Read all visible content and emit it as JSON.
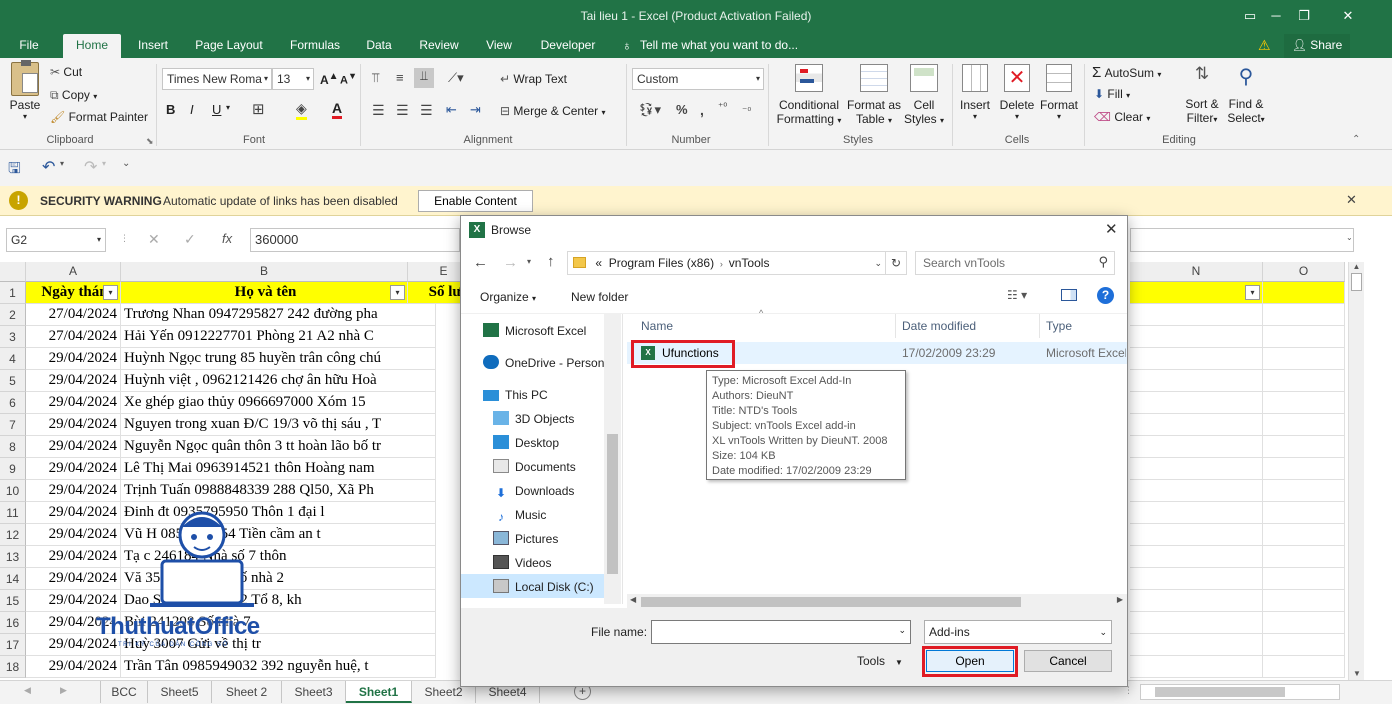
{
  "window": {
    "title": "Tai lieu 1 - Excel (Product Activation Failed)"
  },
  "menu": {
    "tabs": [
      "File",
      "Home",
      "Insert",
      "Page Layout",
      "Formulas",
      "Data",
      "Review",
      "View",
      "Developer"
    ],
    "tell_me": "Tell me what you want to do...",
    "share": "Share"
  },
  "ribbon": {
    "clipboard": {
      "paste": "Paste",
      "cut": "Cut",
      "copy": "Copy",
      "format_painter": "Format Painter",
      "label": "Clipboard"
    },
    "font": {
      "name": "Times New Roma",
      "size": "13",
      "bold": "B",
      "italic": "I",
      "underline": "U",
      "label": "Font"
    },
    "alignment": {
      "wrap_text": "Wrap Text",
      "merge_center": "Merge & Center",
      "label": "Alignment"
    },
    "number": {
      "format": "Custom",
      "label": "Number"
    },
    "styles": {
      "conditional": "Conditional",
      "conditional2": "Formatting",
      "format_as": "Format as",
      "format_as2": "Table",
      "cell": "Cell",
      "cell2": "Styles",
      "label": "Styles"
    },
    "cells": {
      "insert": "Insert",
      "delete": "Delete",
      "format": "Format",
      "label": "Cells"
    },
    "editing": {
      "autosum": "AutoSum",
      "fill": "Fill",
      "clear": "Clear",
      "sort": "Sort &",
      "sort2": "Filter",
      "find": "Find &",
      "find2": "Select",
      "label": "Editing"
    }
  },
  "security": {
    "title": "SECURITY WARNING",
    "message": "Automatic update of links has been disabled",
    "button": "Enable Content"
  },
  "formula": {
    "name_box": "G2",
    "fx": "fx",
    "value": "360000"
  },
  "grid": {
    "columns": {
      "a": "A",
      "b": "B",
      "e": "E",
      "n": "N",
      "o": "O"
    },
    "header": {
      "date": "Ngày thán",
      "name": "Họ và tên",
      "qty": "Số lư"
    },
    "rows": [
      {
        "num": "1"
      },
      {
        "num": "2",
        "date": "27/04/2024",
        "text": "Trương Nhan 0947295827 242 đường pha"
      },
      {
        "num": "3",
        "date": "27/04/2024",
        "text": "Hải Yến 0912227701 Phòng 21 A2 nhà C"
      },
      {
        "num": "4",
        "date": "29/04/2024",
        "text": "Huỳnh Ngọc trung 85 huyền trân công chú"
      },
      {
        "num": "5",
        "date": "29/04/2024",
        "text": "Huỳnh việt , 0962121426 chợ ân hữu Hoà"
      },
      {
        "num": "6",
        "date": "29/04/2024",
        "text": " Xe ghép giao thủy 0966697000 Xóm 15"
      },
      {
        "num": "7",
        "date": "29/04/2024",
        "text": "Nguyen trong xuan Đ/C 19/3 võ thị sáu , T"
      },
      {
        "num": "8",
        "date": "29/04/2024",
        "text": "Nguyễn Ngọc quân thôn 3 tt hoàn lão bố tr"
      },
      {
        "num": "9",
        "date": "29/04/2024",
        "text": "Lê Thị Mai 0963914521 thôn Hoàng nam"
      },
      {
        "num": "10",
        "date": "29/04/2024",
        "text": "Trịnh Tuấn 0988848339 288 Ql50, Xã Ph"
      },
      {
        "num": "11",
        "date": "29/04/2024",
        "text": "Đinh           đt 0935795950 Thôn 1 đại l"
      },
      {
        "num": "12",
        "date": "29/04/2024",
        "text": "Vũ H          0852865154 Tiền cầm an t"
      },
      {
        "num": "13",
        "date": "29/04/2024",
        "text": "Tạ c           246184 Nhà số 7 thôn"
      },
      {
        "num": "14",
        "date": "29/04/2024",
        "text": " Vă           35981 Địa chỉ số nhà 2"
      },
      {
        "num": "15",
        "date": "29/04/2024",
        "text": "Dao          Sdt0975163772 Tổ 8, kh"
      },
      {
        "num": "16",
        "date": "29/04/2024",
        "text": "Bùi          241298 Số nhà 7"
      },
      {
        "num": "17",
        "date": "29/04/2024",
        "text": "Huỳ          3007 Gửi về thị tr"
      },
      {
        "num": "18",
        "date": "29/04/2024",
        "text": "Trần Tân 0985949032 392  nguyễn huệ, t"
      }
    ]
  },
  "sheets": [
    "BCC",
    "Sheet5",
    "Sheet 2",
    "Sheet3",
    "Sheet1",
    "Sheet2",
    "Sheet4"
  ],
  "dialog": {
    "title": "Browse",
    "path": {
      "prefix": "«",
      "part1": "Program Files (x86)",
      "part2": "vnTools"
    },
    "search_placeholder": "Search vnTools",
    "organize": "Organize",
    "new_folder": "New folder",
    "nav": [
      "Microsoft Excel",
      "OneDrive - Person",
      "This PC",
      "3D Objects",
      "Desktop",
      "Documents",
      "Downloads",
      "Music",
      "Pictures",
      "Videos",
      "Local Disk (C:)"
    ],
    "columns": {
      "name": "Name",
      "date": "Date modified",
      "type": "Type"
    },
    "file": {
      "name": "Ufunctions",
      "date": "17/02/2009 23:29",
      "type": "Microsoft Excel"
    },
    "tooltip": [
      "Type: Microsoft Excel Add-In",
      "Authors: DieuNT",
      "Title: NTD's Tools",
      "Subject: vnTools Excel add-in",
      "XL vnTools Written by DieuNT. 2008",
      "Size: 104 KB",
      "Date modified: 17/02/2009 23:29"
    ],
    "file_name_label": "File name:",
    "file_name_value": "",
    "filter": "Add-ins",
    "tools": "Tools",
    "open": "Open",
    "cancel": "Cancel"
  },
  "watermark": {
    "brand": "ThuthuatOffice",
    "tagline": "TRI KỶ CỦA DÂN CÔNG SỞ"
  },
  "colors": {
    "excel_green": "#217346",
    "highlight_red": "#e01b24",
    "header_yellow": "#ffff00",
    "security_bg": "#fff4ce"
  }
}
